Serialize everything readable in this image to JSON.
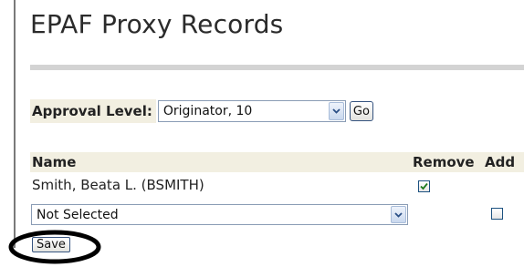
{
  "page": {
    "title": "EPAF Proxy Records"
  },
  "approval": {
    "label": "Approval Level:",
    "selected": "Originator, 10",
    "go_label": "Go"
  },
  "table": {
    "columns": [
      "Name",
      "Remove",
      "Add"
    ],
    "rows": [
      {
        "name": "Smith, Beata L. (BSMITH)",
        "remove_checked": true
      }
    ],
    "new_row": {
      "selected": "Not Selected",
      "add_checked": false
    }
  },
  "actions": {
    "save_label": "Save"
  },
  "colors": {
    "header_band": "#f2efe1",
    "divider": "#d3d3d3",
    "check": "#1d7a1d",
    "annotation_ellipse": "#000000"
  },
  "icons": {
    "dropdown": "chevron-down-icon",
    "checkmark": "check-icon"
  }
}
